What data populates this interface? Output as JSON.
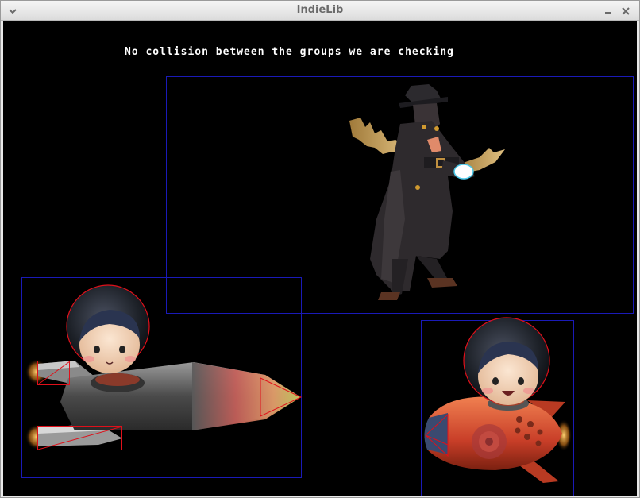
{
  "window": {
    "title": "IndieLib"
  },
  "canvas": {
    "status_text": "No collision between the groups we are checking"
  },
  "icons": {
    "menu": "chevron-down-icon",
    "minimize": "minimize-icon",
    "close": "close-icon"
  },
  "colors": {
    "canvas_background": "#000000",
    "bounding_box": "#1a1ab8",
    "collision_outline": "#e0101a",
    "text": "#ffffff"
  },
  "sprites": [
    {
      "name": "swordsman-sprite"
    },
    {
      "name": "grey-rocket-sprite"
    },
    {
      "name": "red-rocket-sprite"
    }
  ]
}
